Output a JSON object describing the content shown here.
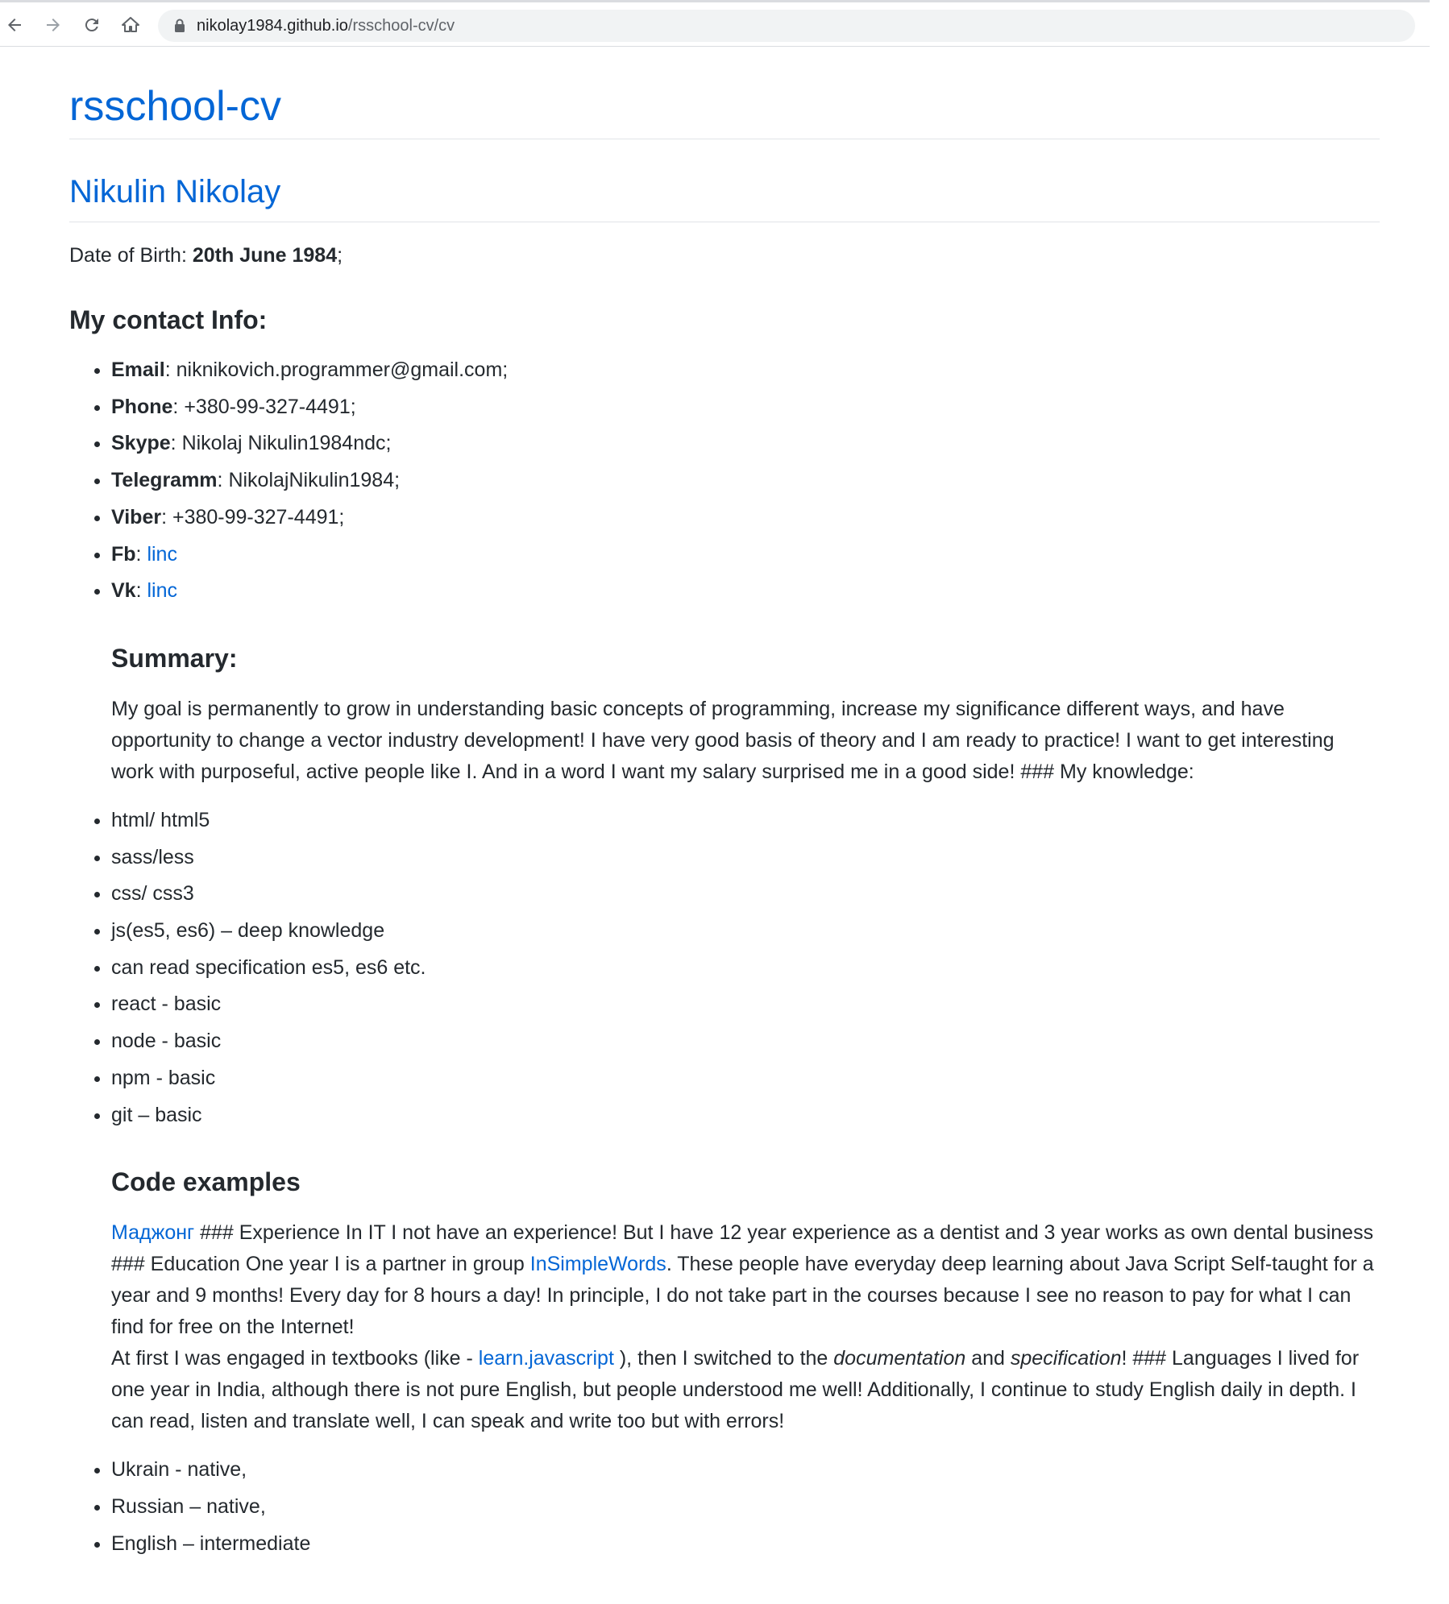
{
  "browser": {
    "url_host": "nikolay1984.github.io",
    "url_path": "/rsschool-cv/cv"
  },
  "site_title": "rsschool-cv",
  "name": "Nikulin Nikolay",
  "dob": {
    "label": "Date of Birth: ",
    "value": "20th June 1984",
    "suffix": ";"
  },
  "contact_heading": "My contact Info:",
  "contacts": [
    {
      "label": "Email",
      "sep": ": ",
      "value": "niknikovich.programmer@gmail.com;"
    },
    {
      "label": "Phone",
      "sep": ": ",
      "value": "+380-99-327-4491;"
    },
    {
      "label": "Skype",
      "sep": ": ",
      "value": "Nikolaj Nikulin1984ndc;"
    },
    {
      "label": "Telegramm",
      "sep": ": ",
      "value": "NikolajNikulin1984;"
    },
    {
      "label": "Viber",
      "sep": ": ",
      "value": "+380-99-327-4491;"
    },
    {
      "label": "Fb",
      "sep": ": ",
      "link": "linc"
    },
    {
      "label": "Vk",
      "sep": ": ",
      "link": "linc"
    }
  ],
  "summary_heading": "Summary:",
  "summary_text": "My goal is permanently to grow in understanding basic concepts of programming, increase my significance different ways, and have opportunity to change a vector industry development! I have very good basis of theory and I am ready to practice! I want to get interesting work with purposeful, active people like I. And in a word I want my salary surprised me in a good side! ### My knowledge:",
  "knowledge": [
    "html/ html5",
    "sass/less",
    "css/ css3",
    "js(es5, es6) – deep knowledge",
    "can read specification es5, es6 etc.",
    "react - basic",
    "node - basic",
    "npm - basic",
    "git – basic"
  ],
  "code_heading": "Code examples",
  "code_para": {
    "link1": "Маджонг",
    "text1": " ### Experience In IT I not have an experience! But I have 12 year experience as a dentist and 3 year works as own dental business ### Education One year I is a partner in group ",
    "link2": "InSimpleWords",
    "text2": ". These people have everyday deep learning about Java Script Self-taught for a year and 9 months! Every day for 8 hours a day! In principle, I do not take part in the courses because I see no reason to pay for what I can find for free on the Internet!",
    "text3": "At first I was engaged in textbooks (like - ",
    "link3": "learn.javascript",
    "text4": " ), then I switched to the ",
    "em1": "documentation",
    "text5": " and ",
    "em2": "specification",
    "text6": "! ### Languages I lived for one year in India, although there is not pure English, but people understood me well! Additionally, I continue to study English daily in depth. I can read, listen and translate well, I can speak and write too but with errors!"
  },
  "languages": [
    "Ukrain - native,",
    "Russian – native,",
    "English – intermediate"
  ],
  "colors": {
    "link": "#0366d6",
    "text": "#24292e",
    "rule": "#e1e4e8"
  }
}
